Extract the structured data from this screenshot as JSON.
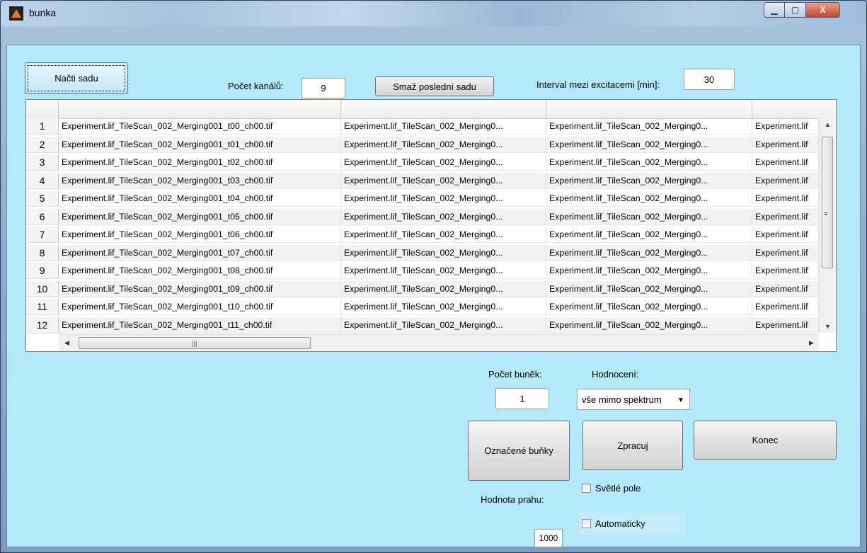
{
  "window": {
    "title": "bunka"
  },
  "window_controls": {
    "minimize": "▁",
    "maximize": "▢",
    "close": "X"
  },
  "buttons": {
    "load_set": "Načti sadu",
    "delete_last_set": "Smaž poslední sadu",
    "marked_cells": "Označené buňky",
    "process": "Zpracuj",
    "end": "Konec"
  },
  "channels": {
    "label": "Počet kanálů:",
    "value": "9"
  },
  "interval": {
    "label": "Interval mezi excitacemi [min]:",
    "value": "30"
  },
  "cell_count": {
    "label": "Počet buněk:",
    "value": "1"
  },
  "rating": {
    "label": "Hodnocení:",
    "selected": "vše mimo spektrum"
  },
  "threshold": {
    "label": "Hodnota prahu:",
    "value": "1000"
  },
  "checkboxes": {
    "bright_field": "Světlé pole",
    "automatic": "Automaticky"
  },
  "table": {
    "rows": [
      {
        "num": "1",
        "c1": "Experiment.lif_TileScan_002_Merging001_t00_ch00.tif",
        "c2": "Experiment.lif_TileScan_002_Merging0...",
        "c3": "Experiment.lif_TileScan_002_Merging0...",
        "c4": "Experiment.lif"
      },
      {
        "num": "2",
        "c1": "Experiment.lif_TileScan_002_Merging001_t01_ch00.tif",
        "c2": "Experiment.lif_TileScan_002_Merging0...",
        "c3": "Experiment.lif_TileScan_002_Merging0...",
        "c4": "Experiment.lif"
      },
      {
        "num": "3",
        "c1": "Experiment.lif_TileScan_002_Merging001_t02_ch00.tif",
        "c2": "Experiment.lif_TileScan_002_Merging0...",
        "c3": "Experiment.lif_TileScan_002_Merging0...",
        "c4": "Experiment.lif"
      },
      {
        "num": "4",
        "c1": "Experiment.lif_TileScan_002_Merging001_t03_ch00.tif",
        "c2": "Experiment.lif_TileScan_002_Merging0...",
        "c3": "Experiment.lif_TileScan_002_Merging0...",
        "c4": "Experiment.lif"
      },
      {
        "num": "5",
        "c1": "Experiment.lif_TileScan_002_Merging001_t04_ch00.tif",
        "c2": "Experiment.lif_TileScan_002_Merging0...",
        "c3": "Experiment.lif_TileScan_002_Merging0...",
        "c4": "Experiment.lif"
      },
      {
        "num": "6",
        "c1": "Experiment.lif_TileScan_002_Merging001_t05_ch00.tif",
        "c2": "Experiment.lif_TileScan_002_Merging0...",
        "c3": "Experiment.lif_TileScan_002_Merging0...",
        "c4": "Experiment.lif"
      },
      {
        "num": "7",
        "c1": "Experiment.lif_TileScan_002_Merging001_t06_ch00.tif",
        "c2": "Experiment.lif_TileScan_002_Merging0...",
        "c3": "Experiment.lif_TileScan_002_Merging0...",
        "c4": "Experiment.lif"
      },
      {
        "num": "8",
        "c1": "Experiment.lif_TileScan_002_Merging001_t07_ch00.tif",
        "c2": "Experiment.lif_TileScan_002_Merging0...",
        "c3": "Experiment.lif_TileScan_002_Merging0...",
        "c4": "Experiment.lif"
      },
      {
        "num": "9",
        "c1": "Experiment.lif_TileScan_002_Merging001_t08_ch00.tif",
        "c2": "Experiment.lif_TileScan_002_Merging0...",
        "c3": "Experiment.lif_TileScan_002_Merging0...",
        "c4": "Experiment.lif"
      },
      {
        "num": "10",
        "c1": "Experiment.lif_TileScan_002_Merging001_t09_ch00.tif",
        "c2": "Experiment.lif_TileScan_002_Merging0...",
        "c3": "Experiment.lif_TileScan_002_Merging0...",
        "c4": "Experiment.lif"
      },
      {
        "num": "11",
        "c1": "Experiment.lif_TileScan_002_Merging001_t10_ch00.tif",
        "c2": "Experiment.lif_TileScan_002_Merging0...",
        "c3": "Experiment.lif_TileScan_002_Merging0...",
        "c4": "Experiment.lif"
      },
      {
        "num": "12",
        "c1": "Experiment.lif_TileScan_002_Merging001_t11_ch00.tif",
        "c2": "Experiment.lif_TileScan_002_Merging0...",
        "c3": "Experiment.lif_TileScan_002_Merging0...",
        "c4": "Experiment.lif"
      }
    ]
  }
}
